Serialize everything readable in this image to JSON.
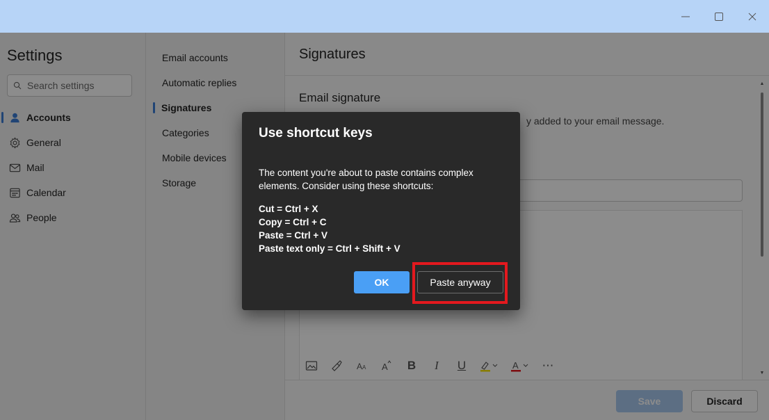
{
  "window": {
    "minimize_icon": "minimize-icon",
    "maximize_icon": "maximize-icon",
    "close_icon": "close-icon"
  },
  "sidebar": {
    "title": "Settings",
    "search_placeholder": "Search settings",
    "items": [
      {
        "label": "Accounts",
        "icon": "person-icon",
        "active": true
      },
      {
        "label": "General",
        "icon": "gear-icon",
        "active": false
      },
      {
        "label": "Mail",
        "icon": "mail-icon",
        "active": false
      },
      {
        "label": "Calendar",
        "icon": "calendar-icon",
        "active": false
      },
      {
        "label": "People",
        "icon": "people-icon",
        "active": false
      }
    ]
  },
  "accounts_menu": {
    "items": [
      {
        "label": "Email accounts",
        "active": false
      },
      {
        "label": "Automatic replies",
        "active": false
      },
      {
        "label": "Signatures",
        "active": true
      },
      {
        "label": "Categories",
        "active": false
      },
      {
        "label": "Mobile devices",
        "active": false
      },
      {
        "label": "Storage",
        "active": false
      }
    ]
  },
  "main": {
    "title": "Signatures",
    "section_title": "Email signature",
    "description_fragment": "y added to your email message.",
    "save_label": "Save",
    "discard_label": "Discard"
  },
  "dialog": {
    "title": "Use shortcut keys",
    "body": "The content you're about to paste contains complex elements. Consider using these shortcuts:",
    "shortcuts": [
      "Cut = Ctrl + X",
      "Copy = Ctrl + C",
      "Paste = Ctrl + V",
      "Paste text only = Ctrl + Shift + V"
    ],
    "ok_label": "OK",
    "paste_anyway_label": "Paste anyway"
  },
  "colors": {
    "accent": "#4a9ff5",
    "highlight": "#e3191e",
    "titlebar": "#b7d4f7",
    "dialog_bg": "#292929"
  }
}
